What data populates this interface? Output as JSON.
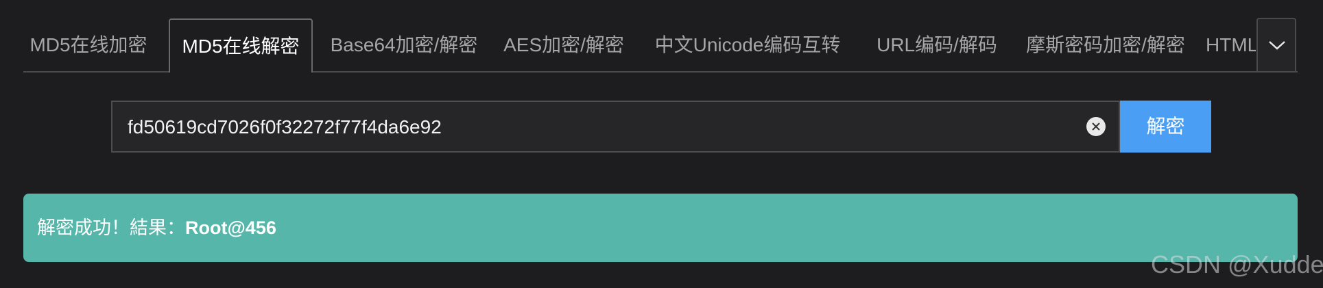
{
  "tabs": [
    {
      "label": "MD5在线加密"
    },
    {
      "label": "MD5在线解密"
    },
    {
      "label": "Base64加密/解密"
    },
    {
      "label": "AES加密/解密"
    },
    {
      "label": "中文Unicode编码互转"
    },
    {
      "label": "URL编码/解码"
    },
    {
      "label": "摩斯密码加密/解密"
    },
    {
      "label": "HTML字"
    }
  ],
  "active_tab_index": 1,
  "tab_more_icon": "chevron-down-icon",
  "search": {
    "value": "fd50619cd7026f0f32272f77f4da6e92",
    "clear_icon": "close-icon",
    "button_label": "解密"
  },
  "result": {
    "prefix": "解密成功！結果：",
    "value": "Root@456"
  },
  "watermark": "CSDN @Xudde.",
  "colors": {
    "background": "#1d1d1f",
    "button": "#4a9ff5",
    "result_bg": "#56b6aa"
  }
}
